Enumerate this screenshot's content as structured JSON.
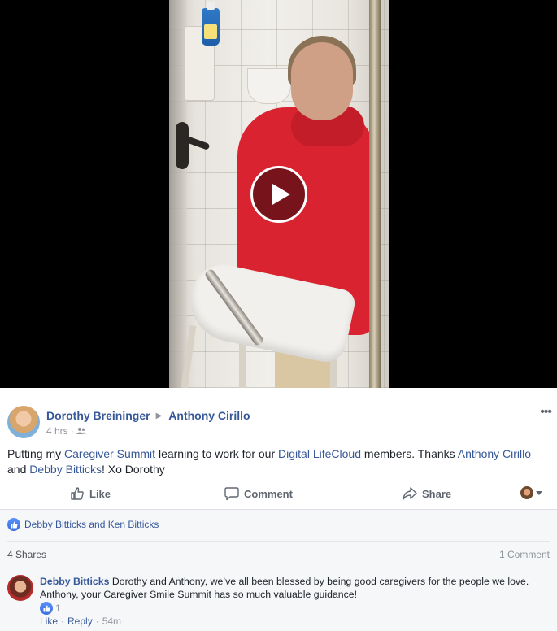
{
  "post": {
    "author": "Dorothy Breininger",
    "target": "Anthony Cirillo",
    "time": "4 hrs",
    "separator": "·",
    "text": {
      "part1": "Putting my ",
      "link1": "Caregiver Summit",
      "part2": " learning to work for our ",
      "link2": "Digital LifeCloud",
      "part3": " members. Thanks ",
      "link3": "Anthony Cirillo",
      "part4": " and ",
      "link4": "Debby Bitticks",
      "part5": "! Xo Dorothy"
    }
  },
  "actions": {
    "like": "Like",
    "comment": "Comment",
    "share": "Share"
  },
  "reactions": {
    "names": "Debby Bitticks and Ken Bitticks"
  },
  "stats": {
    "shares": "4 Shares",
    "comments": "1 Comment"
  },
  "comment": {
    "author": "Debby Bitticks",
    "text": "Dorothy and Anthony, we’ve all been blessed by being good caregivers for the people we love. Anthony, your Caregiver Smile Summit has so much valuable guidance!",
    "like_count": "1",
    "like": "Like",
    "dot": "·",
    "reply": "Reply",
    "time": "54m"
  },
  "colors": {
    "link": "#365899",
    "muted": "#90949c",
    "like_blue": "#4080ff",
    "video_bg": "#000000"
  },
  "icons": [
    "play-icon",
    "friends-audience-icon",
    "more-options-icon",
    "like-icon",
    "comment-icon",
    "share-icon",
    "like-reaction-icon",
    "chevron-down-icon"
  ]
}
